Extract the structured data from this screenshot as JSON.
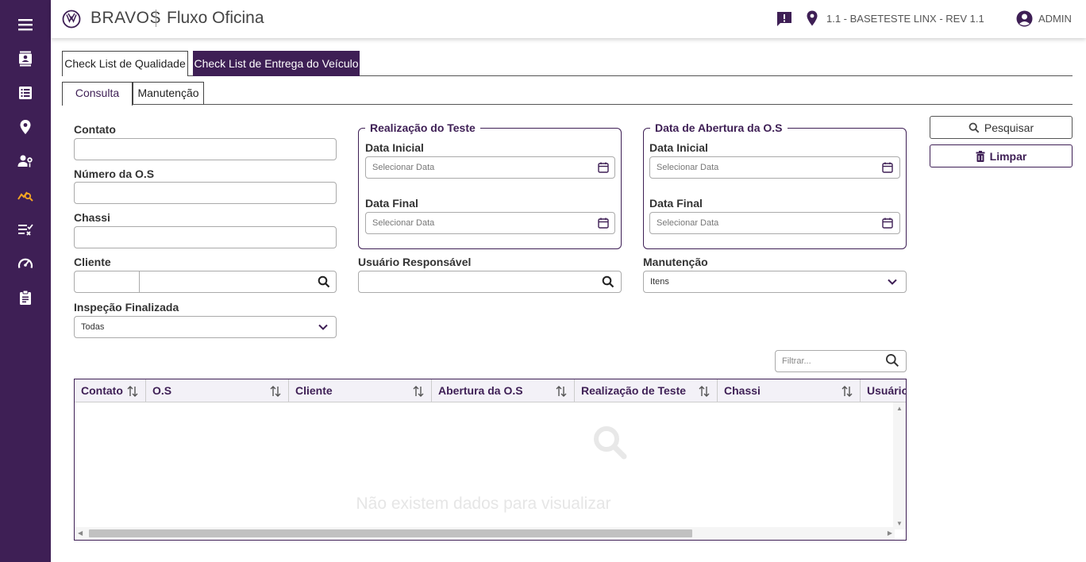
{
  "header": {
    "brand": "BRAVOS",
    "module": "Fluxo Oficina",
    "branch": "1.1 - BASETESTE LINX - REV 1.1",
    "user": "ADMIN"
  },
  "sidebar": {
    "items": [
      {
        "icon": "menu-icon"
      },
      {
        "icon": "contact-card-icon"
      },
      {
        "icon": "list-icon"
      },
      {
        "icon": "location-pin-icon"
      },
      {
        "icon": "user-settings-icon"
      },
      {
        "icon": "analytics-search-icon",
        "active": true
      },
      {
        "icon": "checklist-icon"
      },
      {
        "icon": "speedometer-icon"
      },
      {
        "icon": "clipboard-icon"
      }
    ]
  },
  "tabs": {
    "main": [
      "Check List de Qualidade",
      "Check List de Entrega do Veículo"
    ],
    "active_main": "Check List de Entrega do Veículo",
    "sub": [
      "Consulta",
      "Manutenção"
    ],
    "active_sub": "Consulta"
  },
  "form": {
    "contato_label": "Contato",
    "numero_os_label": "Número da O.S",
    "chassi_label": "Chassi",
    "cliente_label": "Cliente",
    "inspecao_label": "Inspeção Finalizada",
    "inspecao_value": "Todas",
    "realizacao_legend": "Realização do Teste",
    "abertura_legend": "Data de Abertura da O.S",
    "data_inicial_label": "Data Inicial",
    "data_final_label": "Data Final",
    "date_placeholder": "Selecionar Data",
    "usuario_label": "Usuário Responsável",
    "manutencao_label": "Manutenção",
    "manutencao_value": "Itens"
  },
  "buttons": {
    "pesquisar": "Pesquisar",
    "limpar": "Limpar"
  },
  "table": {
    "filter_placeholder": "Filtrar...",
    "columns": [
      "Contato",
      "O.S",
      "Cliente",
      "Abertura da O.S",
      "Realização de Teste",
      "Chassi",
      "Usuário"
    ],
    "rows": [],
    "empty_message": "Não existem dados para visualizar"
  },
  "colors": {
    "primary": "#3e1f55",
    "accent": "#f5a623"
  }
}
